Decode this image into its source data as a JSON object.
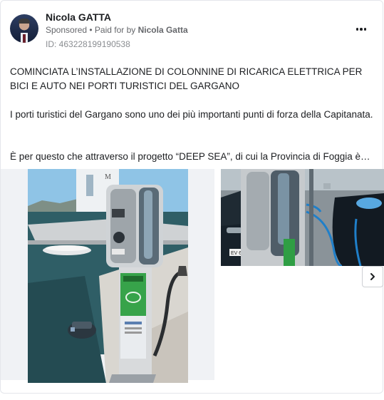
{
  "post": {
    "author": "Nicola GATTA",
    "sponsored_label": "Sponsored",
    "paid_prefix": " • Paid for by ",
    "paid_by": "Nicola Gatta",
    "ad_id": "ID: 463228199190538",
    "more_icon": "more-horizontal-icon",
    "paragraphs": [
      "COMINCIATA L’INSTALLAZIONE DI COLONNINE DI RICARICA ELETTRICA PER BICI E AUTO NEI PORTI TURISTICI DEL GARGANO",
      "I porti turistici del Gargano sono uno dei più importanti punti di forza della Capitanata.",
      "È per questo che attraverso il progetto “DEEP SEA”, di cui la Provincia di Foggia è…"
    ]
  },
  "media": {
    "next_icon": "chevron-right-icon"
  }
}
